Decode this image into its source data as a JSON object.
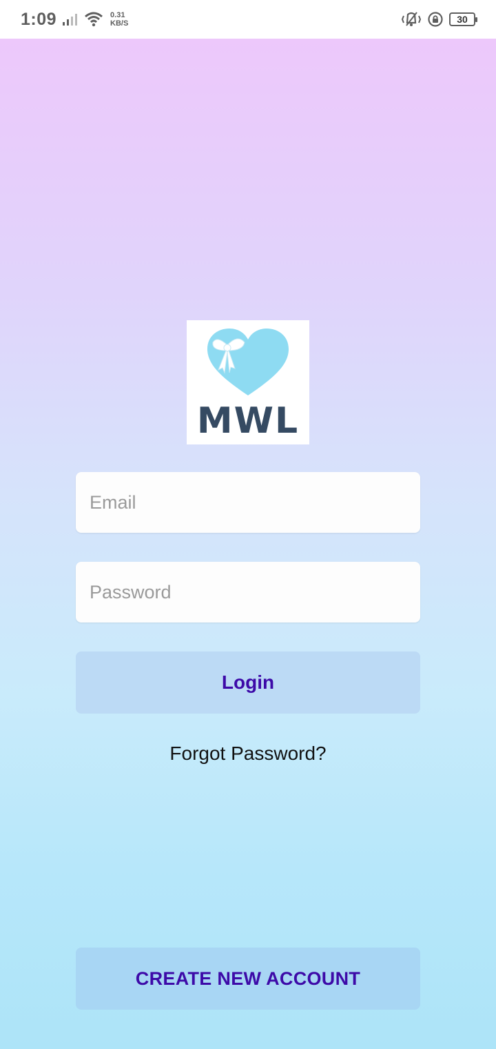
{
  "status_bar": {
    "time": "1:09",
    "speed_value": "0.31",
    "speed_unit": "KB/S",
    "battery": "30",
    "icons": [
      "signal-icon",
      "wifi-icon",
      "vibrate-icon",
      "rotation-lock-icon",
      "battery-icon"
    ]
  },
  "logo": {
    "text": "MWL",
    "heart_color": "#8edbf2",
    "text_color": "#354a62"
  },
  "login_form": {
    "email_placeholder": "Email",
    "password_placeholder": "Password",
    "login_label": "Login",
    "forgot_label": "Forgot Password?"
  },
  "footer": {
    "create_account_label": "CREATE NEW ACCOUNT"
  },
  "colors": {
    "gradient_top": "#edc8fb",
    "gradient_bottom": "#ade4f8",
    "button_text": "#3d0aa8"
  }
}
